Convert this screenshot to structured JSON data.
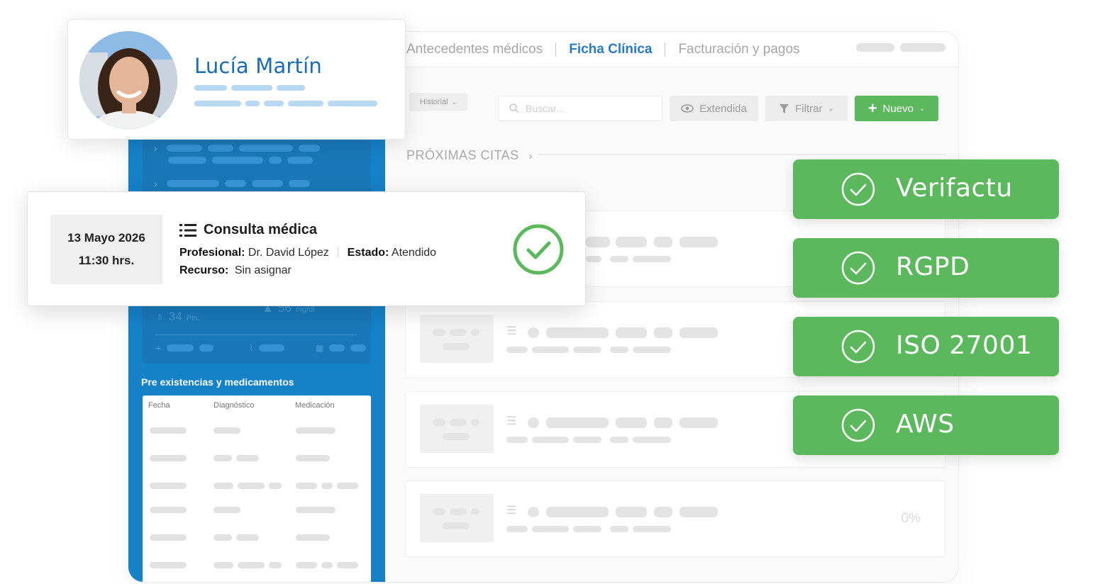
{
  "tabs": [
    {
      "label": "Antecedentes médicos",
      "active": false
    },
    {
      "label": "Ficha Clínica",
      "active": true
    },
    {
      "label": "Facturación y pagos",
      "active": false
    }
  ],
  "toolbar": {
    "history_label": "Historial",
    "search_placeholder": "Buscar...",
    "extended_label": "Extendida",
    "filter_label": "Filtrar",
    "new_label": "Nuevo"
  },
  "section": {
    "upcoming_title": "PRÓXIMAS CITAS"
  },
  "sidebar": {
    "score_text": "34",
    "score_unit": "Pts.",
    "weight_text": "56",
    "weight_unit": "mg/dl",
    "pre_title": "Pre existencias y medicamentos",
    "table_headers": [
      "Fecha",
      "Diagnóstico",
      "Medicación"
    ]
  },
  "patient": {
    "name": "Lucía Martín"
  },
  "appointment": {
    "date": "13 Mayo 2026",
    "time": "11:30 hrs.",
    "title": "Consulta médica",
    "professional_label": "Profesional:",
    "professional_value": "Dr. David López",
    "status_label": "Estado:",
    "status_value": "Atendido",
    "resource_label": "Recurso:",
    "resource_value": "Sin asignar"
  },
  "last_card": {
    "percent": "0%"
  },
  "badges": [
    {
      "label": "Verifactu"
    },
    {
      "label": "RGPD"
    },
    {
      "label": "ISO 27001"
    },
    {
      "label": "AWS"
    }
  ],
  "colors": {
    "brand_blue": "#1582c8",
    "accent_green": "#5cb85c",
    "name_blue": "#1a6cb6"
  }
}
